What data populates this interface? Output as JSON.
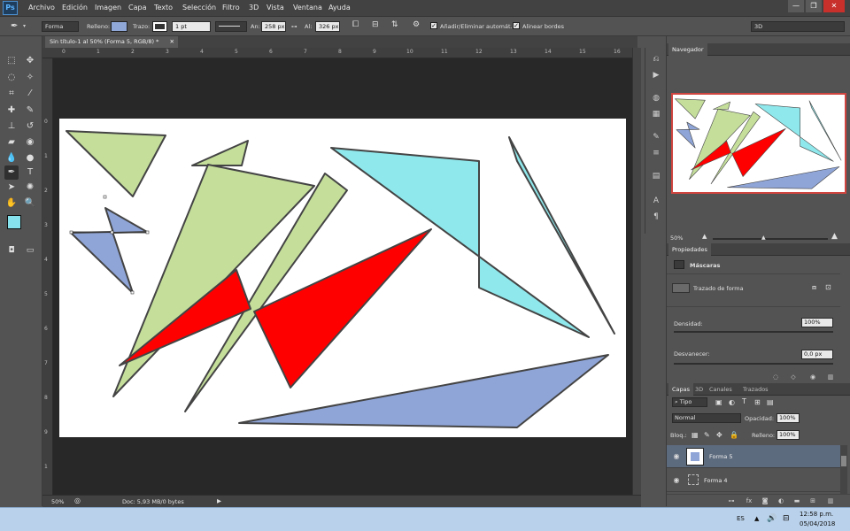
{
  "app": {
    "logo": "Ps"
  },
  "menubar": {
    "items": [
      "Archivo",
      "Edición",
      "Imagen",
      "Capa",
      "Texto",
      "Selección",
      "Filtro",
      "3D",
      "Vista",
      "Ventana",
      "Ayuda"
    ]
  },
  "window_controls": {
    "minimize": "—",
    "restore": "❐",
    "close": "✕"
  },
  "options": {
    "tool_mode": "Forma",
    "fill_label": "Relleno:",
    "fill_color": "#8fa8d8",
    "stroke_label": "Trazo:",
    "stroke_width": "1 pt",
    "width_label": "An:",
    "width_value": "258 px",
    "height_label": "Al:",
    "height_value": "326 px",
    "auto_add_delete": "Añadir/Eliminar automát.",
    "align_edges": "Alinear bordes",
    "workspace": "3D"
  },
  "document": {
    "tab_title": "Sin título-1 al 50% (Forma 5, RGB/8) *",
    "zoom": "50%",
    "doc_info": "Doc: 5,93 MB/0 bytes",
    "ruler_h": [
      "0",
      "1",
      "2",
      "3",
      "4",
      "5",
      "6",
      "7",
      "8",
      "9",
      "10",
      "11",
      "12",
      "13",
      "14",
      "15",
      "16"
    ],
    "ruler_v": [
      "0",
      "1",
      "2",
      "3",
      "4",
      "5",
      "6",
      "7",
      "8",
      "9",
      "1"
    ]
  },
  "colors": {
    "foreground": "#86e3ee",
    "background": "#ffffff",
    "shape_green": "#c5df9b",
    "shape_red": "#ff0000",
    "shape_cyan": "#8fe8ec",
    "shape_blue": "#8fa5d8",
    "stroke": "#444444"
  },
  "navigator": {
    "tab": "Navegador",
    "zoom": "50%"
  },
  "properties": {
    "tab": "Propiedades",
    "section": "Máscaras",
    "item": "Trazado de forma",
    "density_label": "Densidad:",
    "density_value": "100%",
    "feather_label": "Desvanecer:",
    "feather_value": "0,0 px"
  },
  "layers": {
    "tabs": [
      "Capas",
      "3D",
      "Canales",
      "Trazados"
    ],
    "filter": "Tipo",
    "blend_mode": "Normal",
    "opacity_label": "Opacidad:",
    "opacity_value": "100%",
    "lock_label": "Bloq.:",
    "fill_label": "Relleno:",
    "fill_value": "100%",
    "items": [
      {
        "name": "Forma 5",
        "selected": true
      },
      {
        "name": "Forma 4",
        "selected": false
      }
    ]
  },
  "taskbar": {
    "lang": "ES",
    "time": "12:58 p.m.",
    "date": "05/04/2018"
  }
}
